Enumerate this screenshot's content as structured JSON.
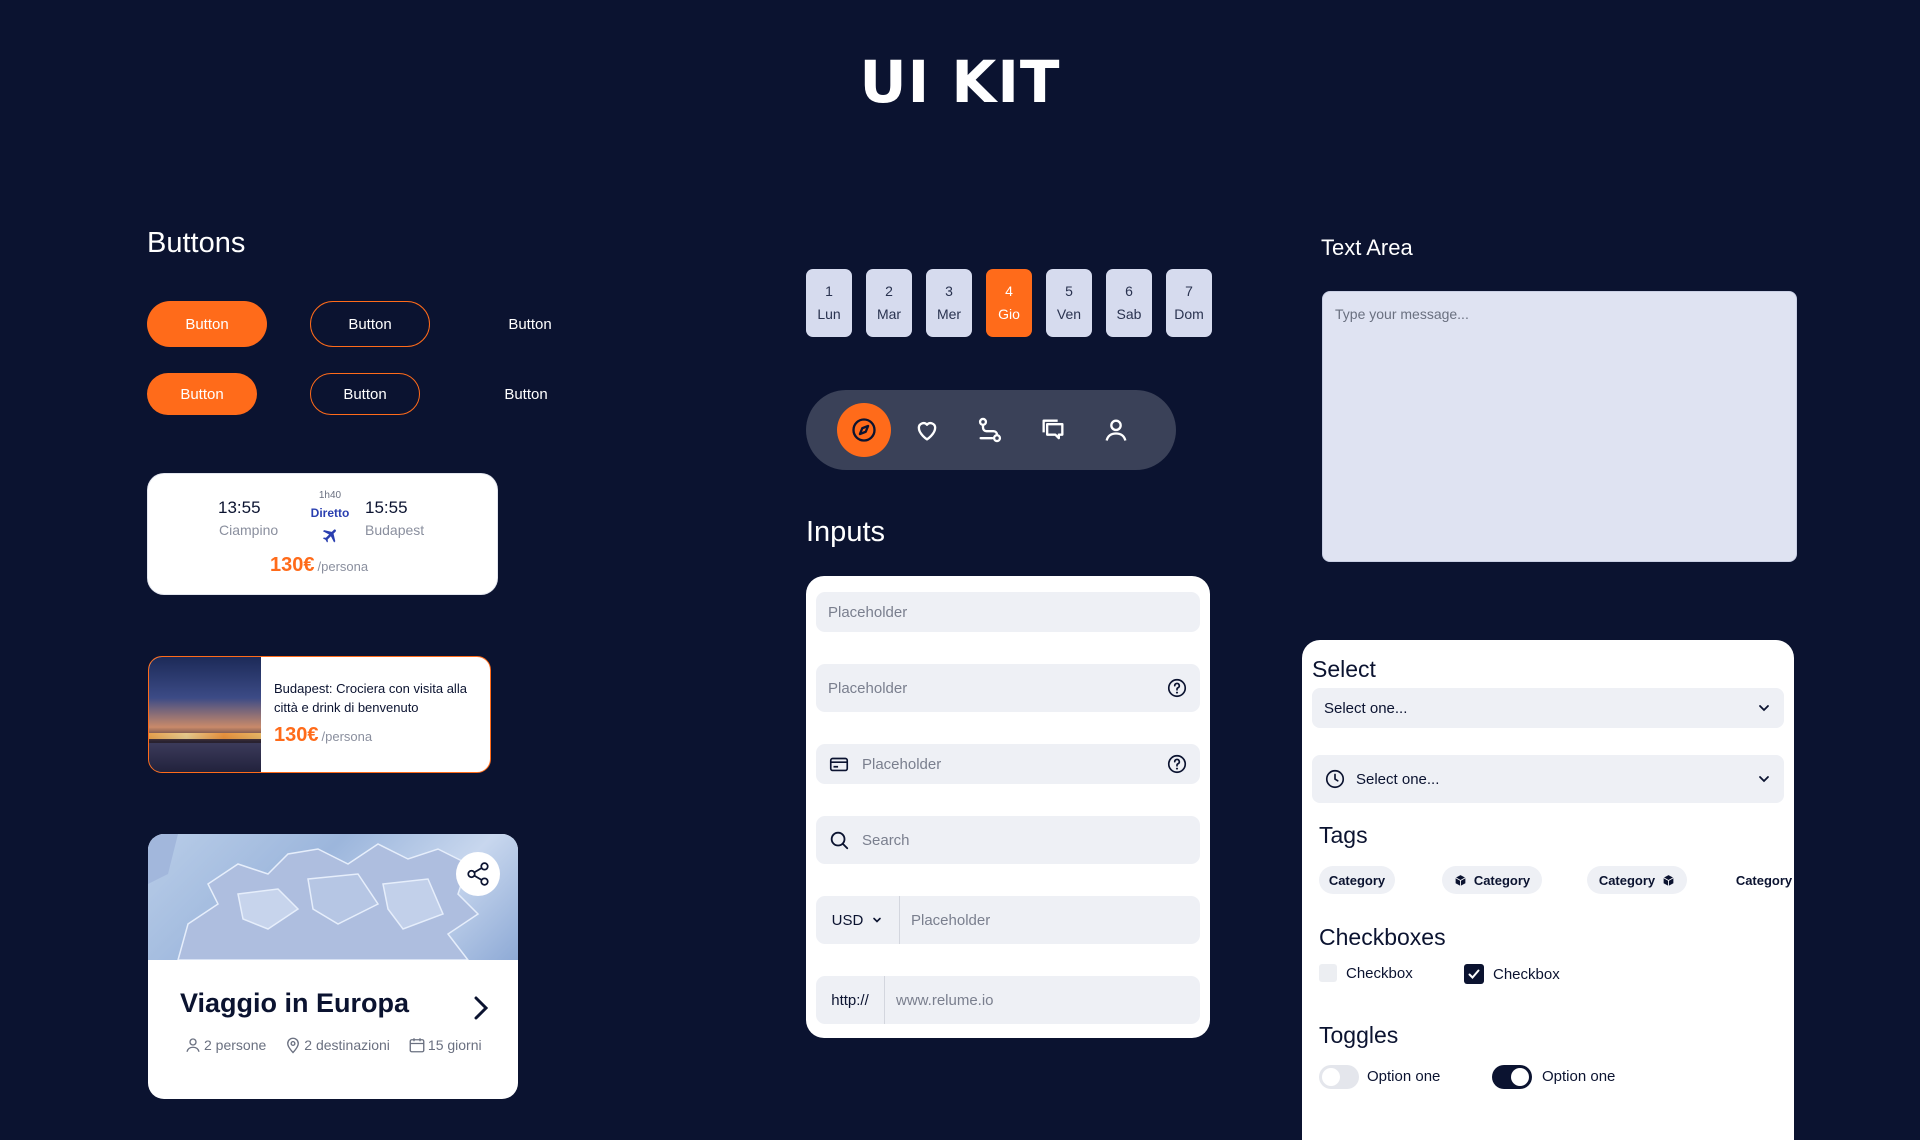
{
  "page": {
    "title": "UI KIT"
  },
  "buttons": {
    "title": "Buttons",
    "row1": {
      "primary": "Button",
      "secondary": "Button",
      "link": "Button"
    },
    "row2": {
      "primary": "Button",
      "secondary": "Button",
      "link": "Button"
    }
  },
  "flight_card": {
    "depart_time": "13:55",
    "depart_city": "Ciampino",
    "duration": "1h40",
    "type": "Diretto",
    "arrive_time": "15:55",
    "arrive_city": "Budapest",
    "price": "130€",
    "per": "/persona"
  },
  "tour_card": {
    "title": "Budapest: Crociera con visita alla città e drink di benvenuto",
    "price": "130€",
    "per": "/persona"
  },
  "trip_card": {
    "title": "Viaggio in Europa",
    "people": "2 persone",
    "destinations": "2 destinazioni",
    "days": "15 giorni"
  },
  "day_picker": {
    "active_index": 3,
    "days": [
      {
        "num": "1",
        "name": "Lun"
      },
      {
        "num": "2",
        "name": "Mar"
      },
      {
        "num": "3",
        "name": "Mer"
      },
      {
        "num": "4",
        "name": "Gio"
      },
      {
        "num": "5",
        "name": "Ven"
      },
      {
        "num": "6",
        "name": "Sab"
      },
      {
        "num": "7",
        "name": "Dom"
      }
    ]
  },
  "nav_icons": [
    "compass-icon",
    "heart-icon",
    "route-icon",
    "chat-icon",
    "user-icon"
  ],
  "inputs": {
    "title": "Inputs",
    "plain_placeholder": "Placeholder",
    "help_placeholder": "Placeholder",
    "card_placeholder": "Placeholder",
    "search_placeholder": "Search",
    "currency": "USD",
    "currency_placeholder": "Placeholder",
    "url_prefix": "http://",
    "url_placeholder": "www.relume.io"
  },
  "text_area": {
    "title": "Text Area",
    "placeholder": "Type your message..."
  },
  "select": {
    "title": "Select",
    "select1": "Select one...",
    "select2": "Select one..."
  },
  "tags": {
    "title": "Tags",
    "items": [
      "Category",
      "Category",
      "Category",
      "Category"
    ]
  },
  "checkboxes": {
    "title": "Checkboxes",
    "items": [
      {
        "label": "Checkbox",
        "checked": false
      },
      {
        "label": "Checkbox",
        "checked": true
      }
    ]
  },
  "toggles": {
    "title": "Toggles",
    "items": [
      {
        "label": "Option one",
        "on": false
      },
      {
        "label": "Option one",
        "on": true
      }
    ]
  },
  "colors": {
    "background": "#0b1330",
    "accent": "#ff6b1a",
    "navbar": "#3a4158",
    "day_bg": "#d6dbee",
    "input_bg": "#eef0f5",
    "flight_blue": "#2a3fb0"
  }
}
